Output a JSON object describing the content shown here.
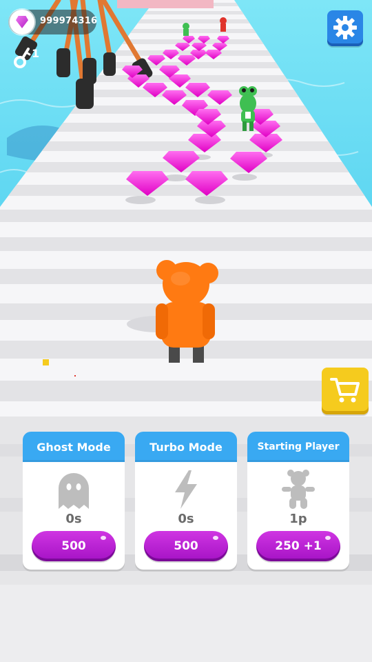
{
  "hud": {
    "gem_count": "999974316",
    "key_count": "1",
    "icons": {
      "gem": "gem-icon",
      "key": "key-icon",
      "settings": "gear-icon",
      "shop": "cart-icon"
    }
  },
  "upgrades": [
    {
      "title": "Ghost Mode",
      "icon": "ghost-icon",
      "value": "0s",
      "price": "500"
    },
    {
      "title": "Turbo Mode",
      "icon": "lightning-icon",
      "value": "0s",
      "price": "500"
    },
    {
      "title": "Starting Player",
      "icon": "teddy-bear-icon",
      "value": "1p",
      "price": "250 +1"
    }
  ],
  "colors": {
    "water": "#5fd9f2",
    "track": "#f3f3f5",
    "gem": "#ff1fd8",
    "player": "#ff7a12",
    "card_header": "#39a9f2",
    "buy_button": "#b51fd1",
    "settings_button": "#2a86e6",
    "shop_button": "#f5cb1e"
  }
}
